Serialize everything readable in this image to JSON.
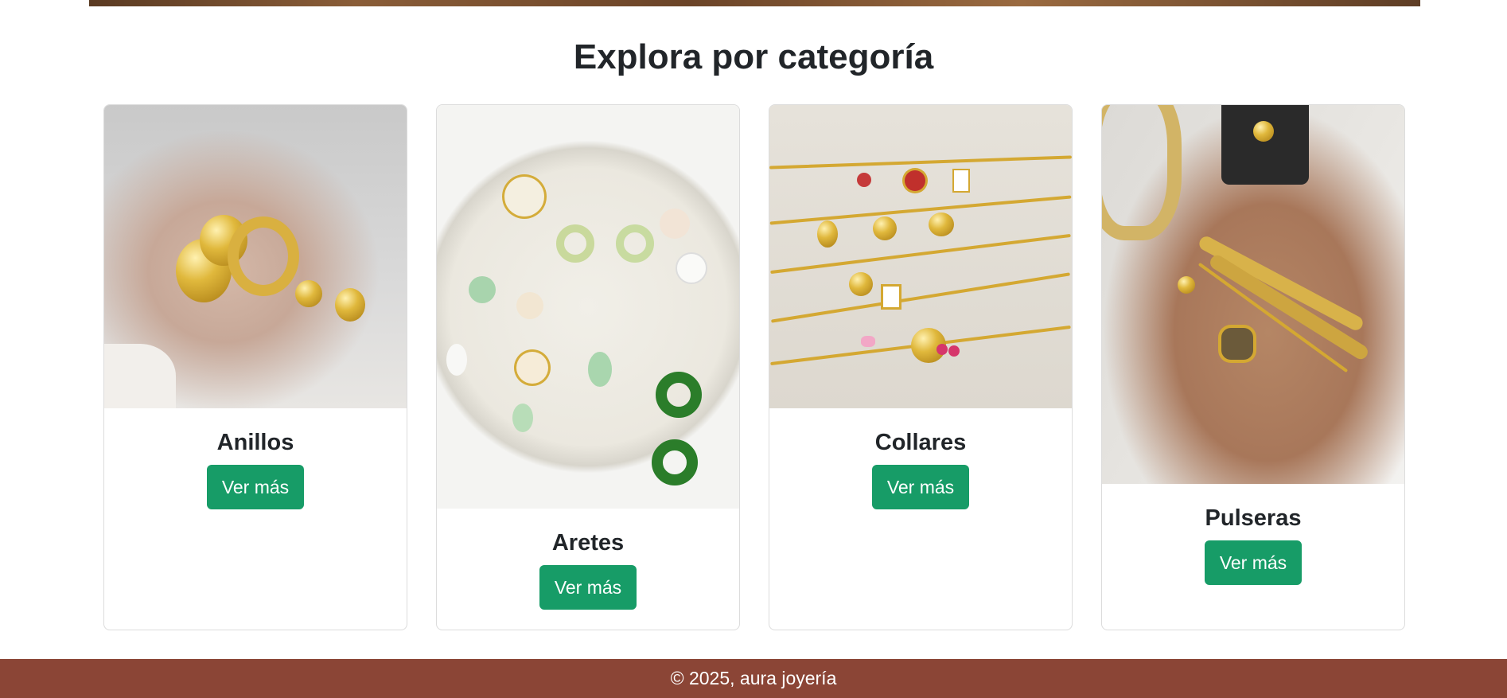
{
  "section": {
    "title": "Explora por categoría"
  },
  "categories": [
    {
      "name": "Anillos",
      "button": "Ver más"
    },
    {
      "name": "Aretes",
      "button": "Ver más"
    },
    {
      "name": "Collares",
      "button": "Ver más"
    },
    {
      "name": "Pulseras",
      "button": "Ver más"
    }
  ],
  "footer": {
    "text": "© 2025, aura joyería"
  },
  "colors": {
    "button": "#179c67",
    "footer": "#8b4536",
    "title": "#212529"
  }
}
